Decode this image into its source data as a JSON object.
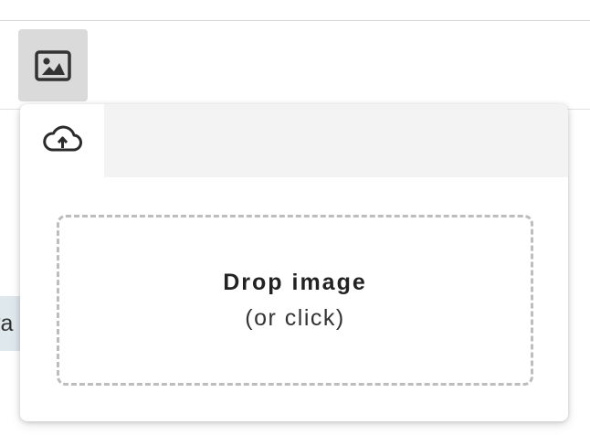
{
  "toolbar": {
    "image_button_icon": "image-icon"
  },
  "background": {
    "partial_text": "va"
  },
  "popover": {
    "tabs": [
      {
        "icon": "cloud-upload-icon",
        "selected": true
      }
    ],
    "dropzone": {
      "title": "Drop image",
      "subtitle": "(or click)"
    }
  },
  "colors": {
    "button_bg": "#dadada",
    "tabbar_bg": "#f3f3f3",
    "dropzone_border": "#bdbdbd",
    "highlight_bg": "#dfe8ec"
  }
}
